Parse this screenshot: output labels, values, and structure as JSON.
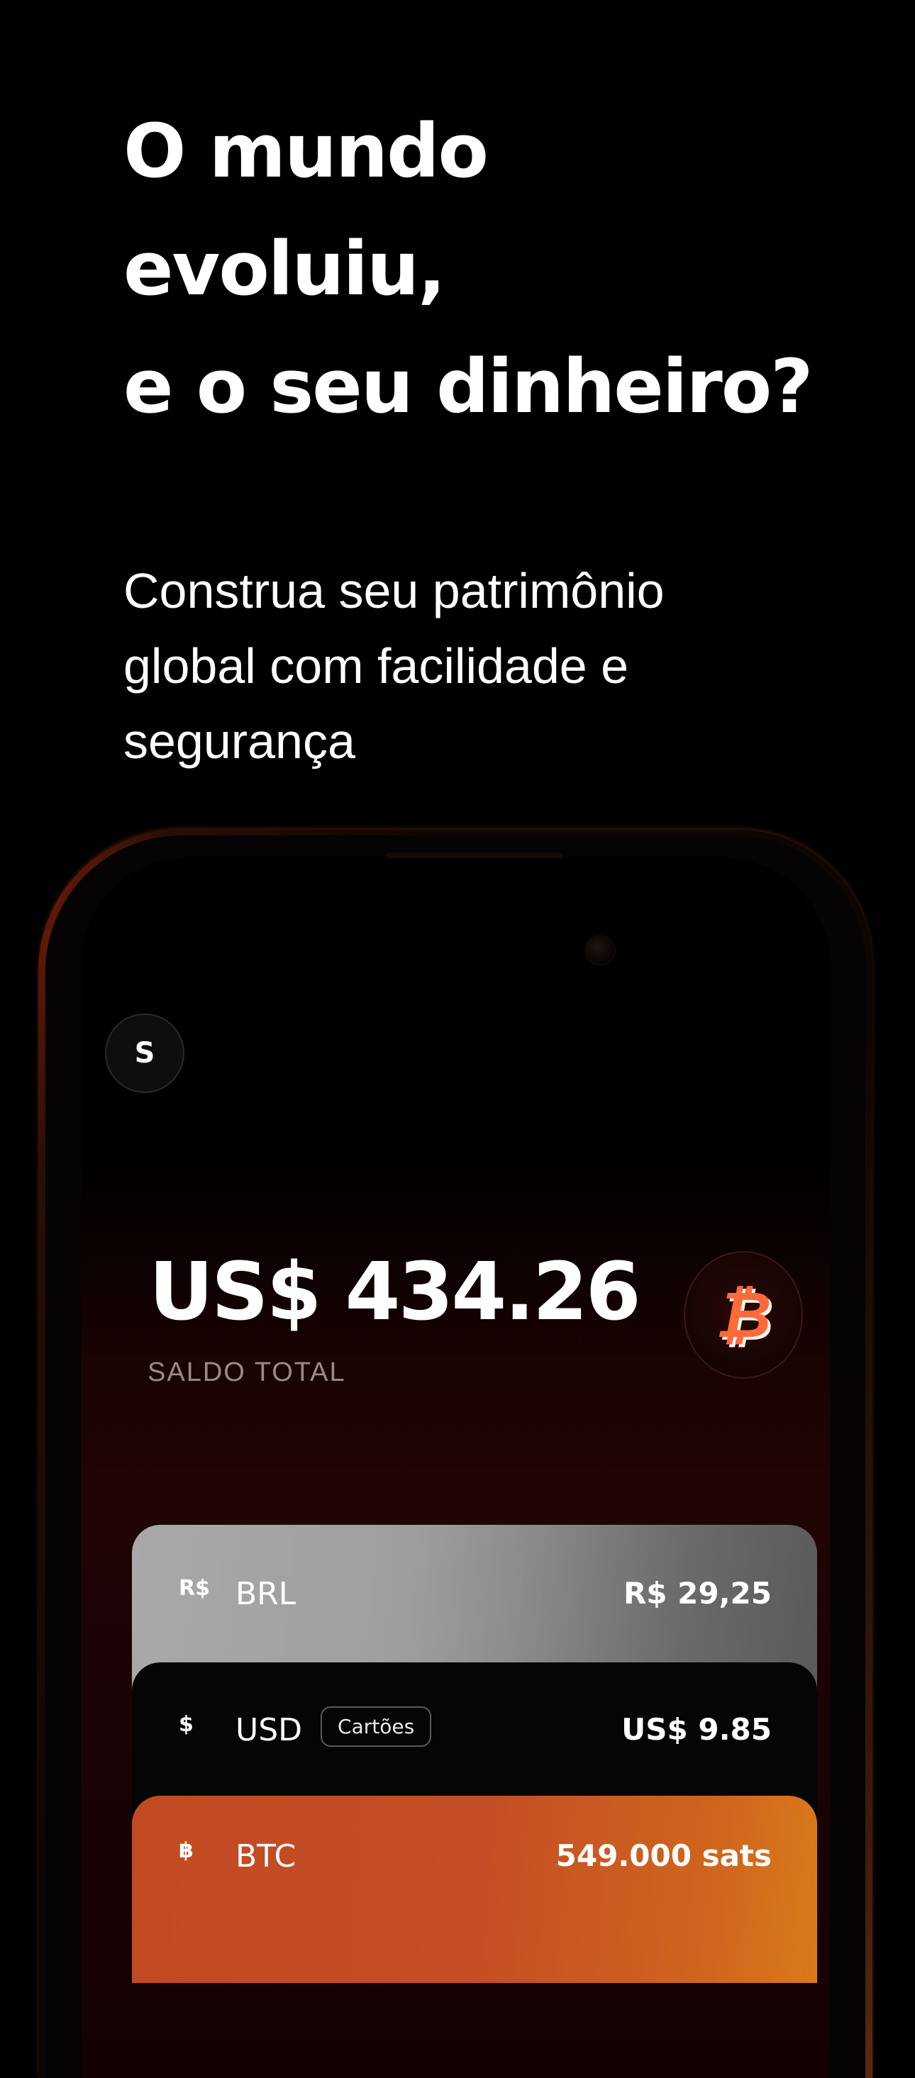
{
  "hero": {
    "headline_line1": "O mundo",
    "headline_line2": "evoluiu,",
    "headline_line3": "e o seu dinheiro?",
    "subtitle_line1": "Construa seu patrimônio",
    "subtitle_line2": "global com facilidade e",
    "subtitle_line3": "segurança"
  },
  "app": {
    "avatar_initial": "S",
    "balance": "US$ 434.26",
    "balance_label": "SALDO TOTAL",
    "btc_badge_icon": "bitcoin-icon",
    "btc_badge_glyph": "₿",
    "accounts": [
      {
        "symbol": "R$",
        "code": "BRL",
        "amount": "R$ 29,25"
      },
      {
        "symbol": "$",
        "code": "USD",
        "tag": "Cartões",
        "amount": "US$ 9.85"
      },
      {
        "symbol": "฿",
        "code": "BTC",
        "amount": "549.000 sats"
      }
    ]
  },
  "colors": {
    "background": "#000000",
    "btc_orange": "#c44e25",
    "brl_card_gray": "#9e9e9e",
    "usd_card_black": "#050505"
  }
}
